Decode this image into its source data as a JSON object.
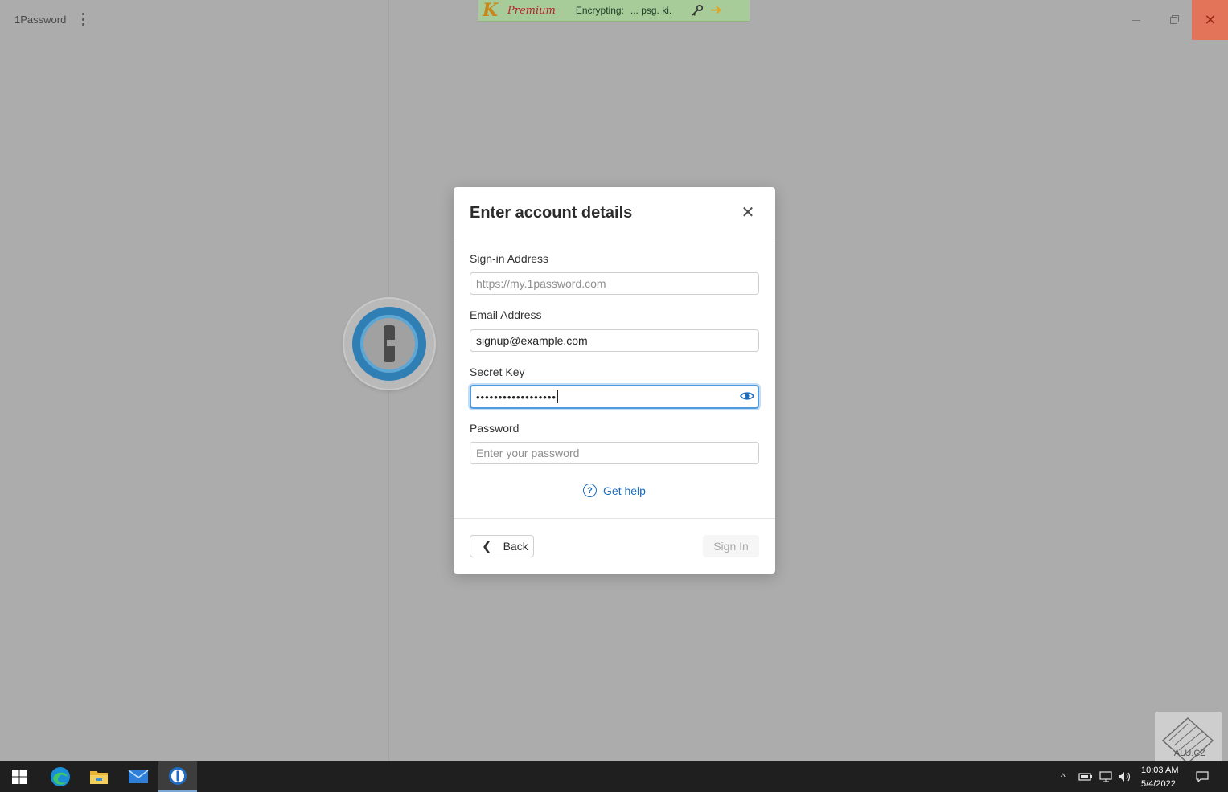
{
  "app": {
    "title": "1Password",
    "menu_icon": "kebab-menu-icon",
    "window_controls": [
      "minimize",
      "restore",
      "close"
    ]
  },
  "banner": {
    "logo_letter": "K",
    "brand": "Premium",
    "status_label": "Encrypting:",
    "status_value": "... psg. ki.",
    "icons": [
      "key-icon",
      "arrow-right-icon"
    ]
  },
  "modal": {
    "title": "Enter account details",
    "sign_in_address": {
      "label": "Sign-in Address",
      "placeholder": "https://my.1password.com",
      "value": ""
    },
    "email": {
      "label": "Email Address",
      "value": "signup@example.com"
    },
    "secret_key": {
      "label": "Secret Key",
      "masked_value": "••••••••••••••••••"
    },
    "password": {
      "label": "Password",
      "placeholder": "Enter your password",
      "value": ""
    },
    "help_link": "Get help",
    "back_button": "Back",
    "sign_in_button": "Sign In"
  },
  "watermark": {
    "text": "ALU.CZ"
  },
  "taskbar": {
    "items": [
      "start-icon",
      "edge-icon",
      "file-explorer-icon",
      "mail-icon",
      "1password-icon"
    ],
    "clock_time": "10:03 AM",
    "clock_date": "5/4/2022"
  },
  "colors": {
    "accent": "#1a6ec0",
    "close_button": "#e37359",
    "banner_bg": "#a7cc9a"
  }
}
